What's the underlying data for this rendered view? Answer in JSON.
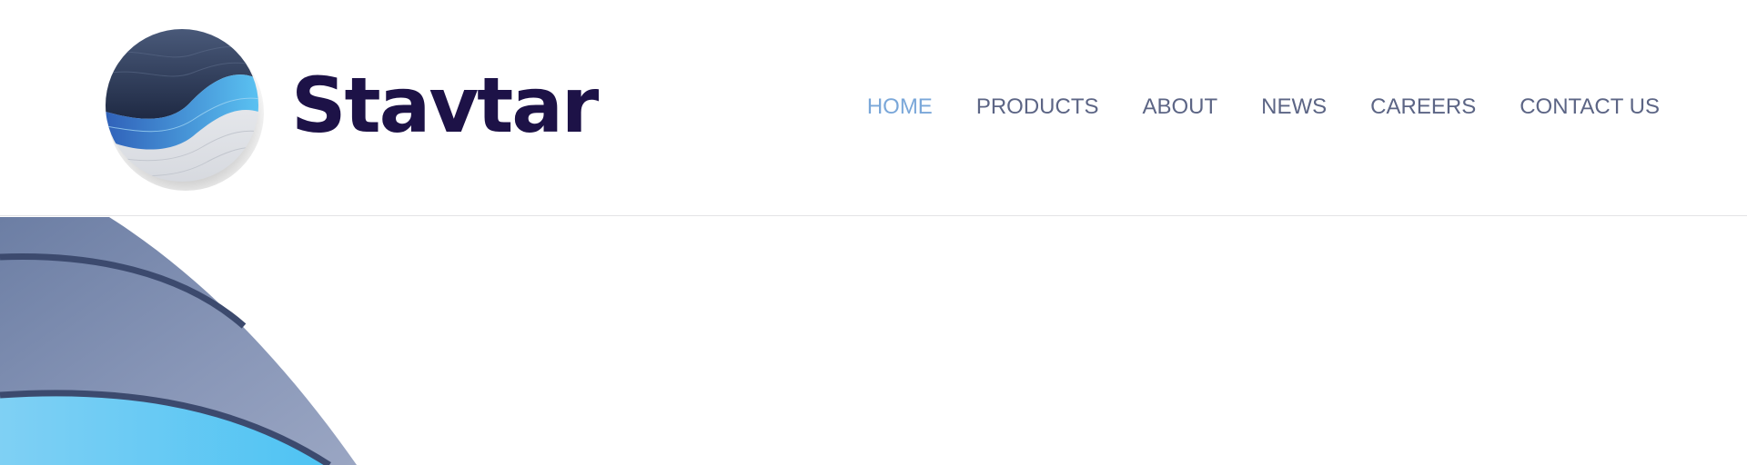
{
  "brand": {
    "name": "Stavtar"
  },
  "nav": {
    "items": [
      {
        "label": "HOME",
        "active": true
      },
      {
        "label": "PRODUCTS",
        "active": false
      },
      {
        "label": "ABOUT",
        "active": false
      },
      {
        "label": "NEWS",
        "active": false
      },
      {
        "label": "CAREERS",
        "active": false
      },
      {
        "label": "CONTACT US",
        "active": false
      }
    ]
  },
  "colors": {
    "brand_text": "#1d1247",
    "nav_text": "#5c6585",
    "nav_active": "#7aa7d9",
    "hero_gray_blue": "#7d8db0",
    "hero_light_blue": "#5ac5f2",
    "hero_stripe": "#3c4a6e"
  },
  "icons": {
    "logo": "sphere-wave-logo-icon"
  }
}
